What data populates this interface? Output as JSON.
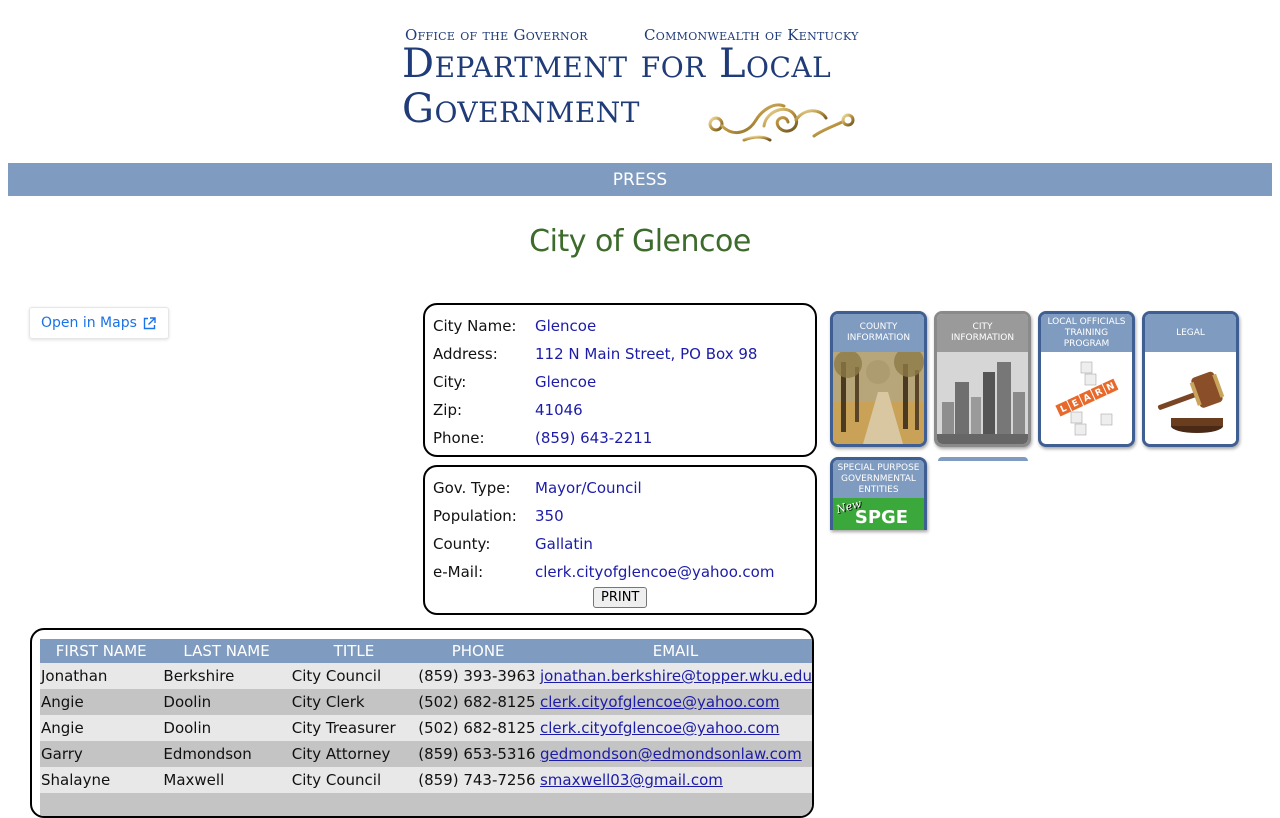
{
  "header": {
    "office": "Office of the Governor",
    "commonwealth": "Commonwealth of Kentucky",
    "line1": "Department for Local",
    "line2": "Government"
  },
  "nav": {
    "press": "PRESS"
  },
  "page_title": "City of Glencoe",
  "maps_button": "Open in Maps",
  "city_info": [
    {
      "label": "City Name:",
      "value": "Glencoe"
    },
    {
      "label": "Address:",
      "value": "112 N Main Street, PO Box 98"
    },
    {
      "label": "City:",
      "value": "Glencoe"
    },
    {
      "label": "Zip:",
      "value": "41046"
    },
    {
      "label": "Phone:",
      "value": "(859) 643-2211"
    }
  ],
  "gov_info": [
    {
      "label": "Gov. Type:",
      "value": "Mayor/Council"
    },
    {
      "label": "Population:",
      "value": "350"
    },
    {
      "label": "County:",
      "value": "Gallatin"
    },
    {
      "label": "e-Mail:",
      "value": "clerk.cityofglencoe@yahoo.com"
    }
  ],
  "print_label": "PRINT",
  "tiles": {
    "county": "County Information",
    "city": "City Information",
    "training": "Local Officials Training Program",
    "legal": "Legal",
    "spge": "Special Purpose Governmental Entities",
    "spge_badge": "SPGE",
    "spge_new": "New"
  },
  "learn_letters": [
    "L",
    "E",
    "A",
    "R",
    "N"
  ],
  "officials": {
    "headers": [
      "FIRST NAME",
      "LAST NAME",
      "TITLE",
      "PHONE",
      "EMAIL"
    ],
    "rows": [
      {
        "first": "Jonathan",
        "last": "Berkshire",
        "title": "City Council",
        "phone": "(859) 393-3963",
        "email": "jonathan.berkshire@topper.wku.edu"
      },
      {
        "first": "Angie",
        "last": "Doolin",
        "title": "City Clerk",
        "phone": "(502) 682-8125",
        "email": "clerk.cityofglencoe@yahoo.com"
      },
      {
        "first": "Angie",
        "last": "Doolin",
        "title": "City Treasurer",
        "phone": "(502) 682-8125",
        "email": "clerk.cityofglencoe@yahoo.com"
      },
      {
        "first": "Garry",
        "last": "Edmondson",
        "title": "City Attorney",
        "phone": "(859) 653-5316",
        "email": "gedmondson@edmondsonlaw.com"
      },
      {
        "first": "Shalayne",
        "last": "Maxwell",
        "title": "City Council",
        "phone": "(859) 743-7256",
        "email": "smaxwell03@gmail.com"
      }
    ]
  },
  "colors": {
    "nav_bar": "#7f9bbf",
    "title_green": "#3d6b2b",
    "header_blue": "#1f3b78",
    "link_blue": "#1c1ca8"
  }
}
